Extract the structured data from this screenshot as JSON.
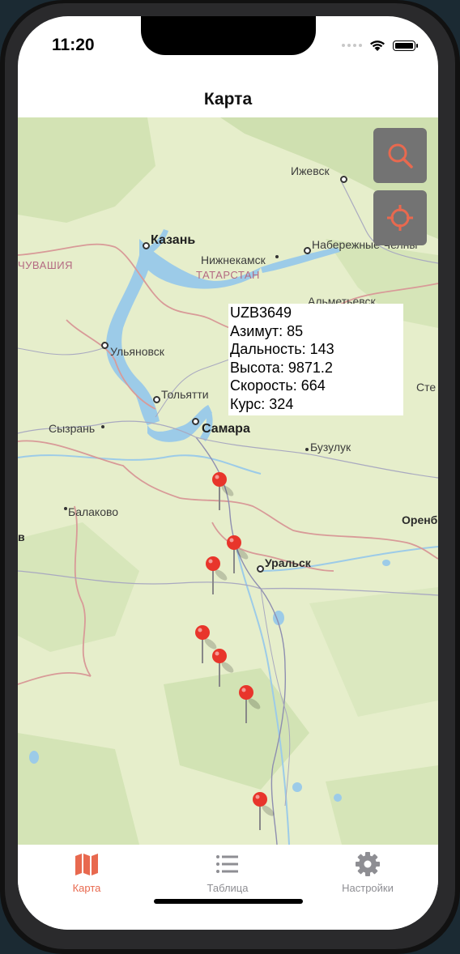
{
  "status_bar": {
    "time": "11:20"
  },
  "nav": {
    "title": "Карта"
  },
  "map": {
    "cities": [
      {
        "name": "Ижевск"
      },
      {
        "name": "Казань"
      },
      {
        "name": "Набережные Челны"
      },
      {
        "name": "Нижнекамск"
      },
      {
        "name": "Альметьевск"
      },
      {
        "name": "Ульяновск"
      },
      {
        "name": "Тольятти"
      },
      {
        "name": "Самара"
      },
      {
        "name": "Сызрань"
      },
      {
        "name": "Бузулук"
      },
      {
        "name": "Балаково"
      },
      {
        "name": "Уральск"
      },
      {
        "name": "Оренб"
      },
      {
        "name": "Сте"
      },
      {
        "name": "в"
      }
    ],
    "regions": [
      {
        "name": "ЧУВАШИЯ"
      },
      {
        "name": "ТАТАРСТАН"
      }
    ],
    "buttons": {
      "search_icon": "search-icon",
      "locate_icon": "crosshair-icon"
    },
    "accent_color": "#e8694f",
    "pin_color": "#e8352b"
  },
  "flight_info": {
    "callsign": "UZB3649",
    "azimuth": "Азимут: 85",
    "distance": "Дальность: 143",
    "altitude": "Высота: 9871.2",
    "speed": "Скорость: 664",
    "course": "Курс: 324"
  },
  "tabs": [
    {
      "label": "Карта",
      "icon": "map-icon",
      "active": true
    },
    {
      "label": "Таблица",
      "icon": "list-icon",
      "active": false
    },
    {
      "label": "Настройки",
      "icon": "gear-icon",
      "active": false
    }
  ]
}
